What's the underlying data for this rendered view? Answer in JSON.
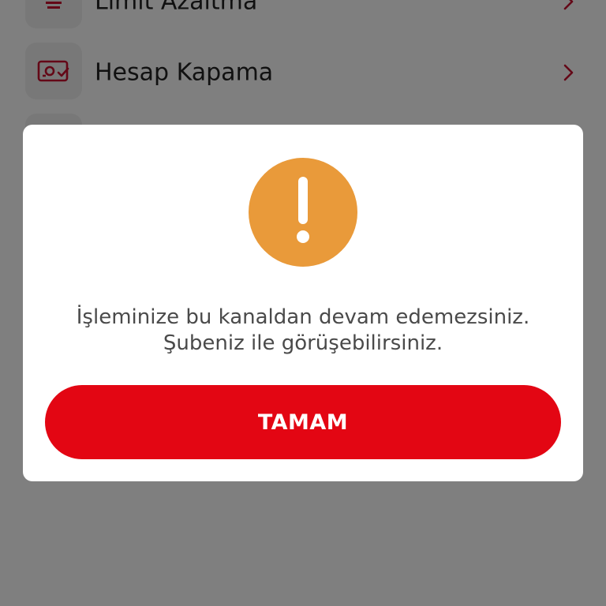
{
  "background_list": {
    "items": [
      {
        "label": "Limit Azaltma",
        "icon": "limit-decrease-icon"
      },
      {
        "label": "Hesap Kapama",
        "icon": "account-close-icon"
      }
    ],
    "chevron_icon": "chevron-right-icon"
  },
  "dialog": {
    "icon": "exclamation-alert-icon",
    "message_line1": "İşleminize bu kanaldan devam edemezsiniz.",
    "message_line2": "Şubeniz ile görüşebilirsiniz.",
    "confirm_label": "TAMAM"
  },
  "colors": {
    "accent_red": "#e30613",
    "alert_orange": "#e99a3a",
    "overlay": "rgba(0,0,0,0.5)"
  }
}
